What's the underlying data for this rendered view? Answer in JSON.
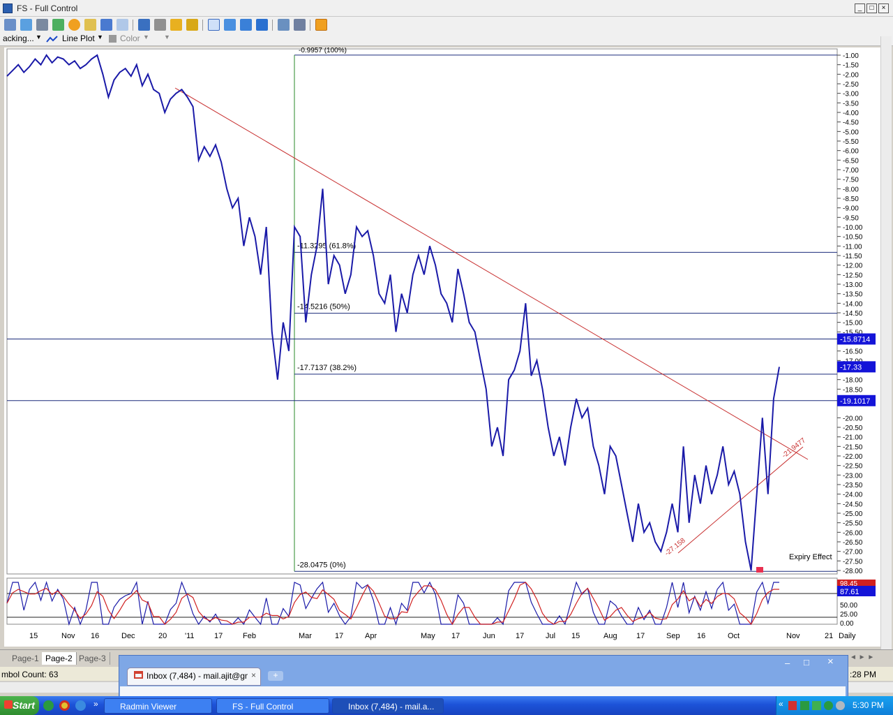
{
  "window": {
    "title": "FS - Full Control"
  },
  "toolbar": {
    "symbol_combo": "acking...",
    "plot_type": "Line Plot",
    "color_label": "Color"
  },
  "chart": {
    "price_ticks": [
      "-1.00",
      "-1.50",
      "-2.00",
      "-2.50",
      "-3.00",
      "-3.50",
      "-4.00",
      "-4.50",
      "-5.00",
      "-5.50",
      "-6.00",
      "-6.50",
      "-7.00",
      "-7.50",
      "-8.00",
      "-8.50",
      "-9.00",
      "-9.50",
      "-10.00",
      "-10.50",
      "-11.00",
      "-11.50",
      "-12.00",
      "-12.50",
      "-13.00",
      "-13.50",
      "-14.00",
      "-14.50",
      "-15.00",
      "-15.50",
      "-16.50",
      "-17.00",
      "-18.00",
      "-18.50",
      "-20.00",
      "-20.50",
      "-21.00",
      "-21.50",
      "-22.00",
      "-22.50",
      "-23.00",
      "-23.50",
      "-24.00",
      "-24.50",
      "-25.00",
      "-25.50",
      "-26.00",
      "-26.50",
      "-27.00",
      "-27.50",
      "-28.00"
    ],
    "price_badges": [
      {
        "label": "-15.8714",
        "value": -15.8714
      },
      {
        "label": "-17.33",
        "value": -17.33
      },
      {
        "label": "-19.1017",
        "value": -19.1017
      }
    ],
    "fib_levels": [
      {
        "label": "-11.3295 (61.8%)",
        "value": -11.3295
      },
      {
        "label": "-14.5216 (50%)",
        "value": -14.5216
      },
      {
        "label": "-17.7137 (38.2%)",
        "value": -17.7137
      },
      {
        "label": "-28.0475 (0%)",
        "value": -28.0475
      }
    ],
    "fib_top_label": "-0.9957 (100%)",
    "trendline_labels": [
      "-27.158",
      "-21.9477"
    ],
    "annotation": "Expiry Effect",
    "x_labels": [
      "15",
      "Nov",
      "16",
      "Dec",
      "20",
      "'11",
      "17",
      "Feb",
      "Mar",
      "17",
      "Apr",
      "May",
      "17",
      "Jun",
      "17",
      "Jul",
      "15",
      "Aug",
      "17",
      "Sep",
      "16",
      "Oct",
      "Nov",
      "21"
    ],
    "period": "Daily",
    "oscillator": {
      "value_label": "87.61",
      "top_label": "98.45",
      "ticks": [
        "50.00",
        "25.00",
        "0.00"
      ]
    }
  },
  "chart_data": {
    "type": "line",
    "series": [
      {
        "values": [
          -2.1,
          -1.8,
          -1.5,
          -1.9,
          -1.6,
          -1.2,
          -1.5,
          -1.0,
          -1.4,
          -1.1,
          -1.2,
          -1.5,
          -1.3,
          -1.7,
          -1.5,
          -1.2,
          -1.0,
          -2.0,
          -3.2,
          -2.3,
          -1.9,
          -1.7,
          -2.1,
          -1.5,
          -2.6,
          -2.0,
          -2.8,
          -3.0,
          -4.0,
          -3.3,
          -3.0,
          -2.8,
          -3.2,
          -3.7,
          -6.5,
          -5.8,
          -6.3,
          -5.7,
          -6.6,
          -8.0,
          -9.0,
          -8.5,
          -11.0,
          -9.5,
          -10.5,
          -12.5,
          -10.0,
          -15.5,
          -18.0,
          -15.0,
          -16.5,
          -10.0,
          -10.5,
          -15.0,
          -12.5,
          -11.0,
          -8.0,
          -13.0,
          -11.5,
          -12.0,
          -13.5,
          -12.5,
          -10.0,
          -10.5,
          -10.2,
          -11.5,
          -13.5,
          -14.0,
          -12.5,
          -15.5,
          -13.5,
          -14.5,
          -12.5,
          -11.5,
          -12.5,
          -11.0,
          -12.0,
          -13.5,
          -14.0,
          -15.0,
          -12.2,
          -13.5,
          -15.0,
          -15.5,
          -17.0,
          -18.5,
          -21.5,
          -20.5,
          -22.0,
          -18.0,
          -17.5,
          -16.5,
          -14.0,
          -17.8,
          -17.0,
          -18.5,
          -20.5,
          -22.0,
          -21.0,
          -22.5,
          -20.5,
          -19.0,
          -20.0,
          -19.5,
          -21.5,
          -22.5,
          -24.0,
          -21.5,
          -22.0,
          -23.5,
          -25.0,
          -26.5,
          -24.5,
          -26.0,
          -25.5,
          -26.5,
          -27.0,
          -26.0,
          -24.5,
          -26.0,
          -21.5,
          -25.5,
          -23.0,
          -24.5,
          -22.5,
          -24.0,
          -23.0,
          -21.5,
          -23.5,
          -22.8,
          -24.0,
          -26.5,
          -28.0,
          -24.0,
          -20.0,
          -24.0,
          -19.0,
          -17.33
        ]
      }
    ],
    "ylim": [
      -28.0475,
      -0.8
    ]
  }
}
